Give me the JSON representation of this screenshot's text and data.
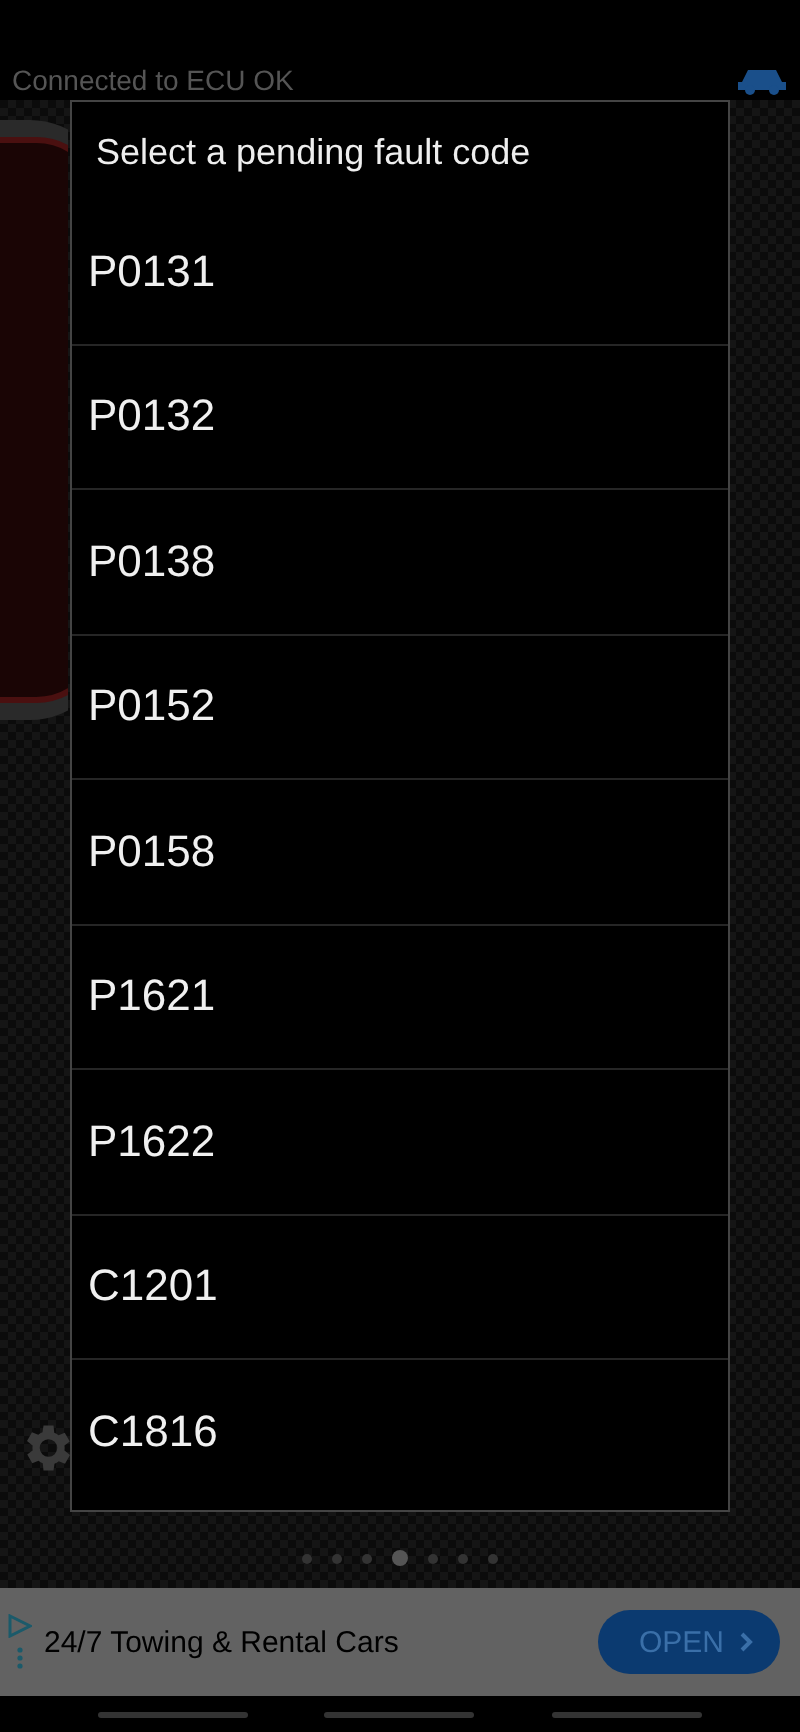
{
  "app_bar": {
    "status": "Connected to ECU OK"
  },
  "dialog": {
    "title": "Select a pending fault code",
    "items": [
      {
        "label": "P0131"
      },
      {
        "label": "P0132"
      },
      {
        "label": "P0138"
      },
      {
        "label": "P0152"
      },
      {
        "label": "P0158"
      },
      {
        "label": "P1621"
      },
      {
        "label": "P1622"
      },
      {
        "label": "C1201"
      },
      {
        "label": "C1816"
      }
    ]
  },
  "pages": [
    {
      "selected": false
    },
    {
      "selected": false
    },
    {
      "selected": false
    },
    {
      "selected": true
    },
    {
      "selected": false
    },
    {
      "selected": false
    },
    {
      "selected": false
    }
  ],
  "ad": {
    "text": "24/7 Towing & Rental Cars",
    "button": "OPEN"
  }
}
